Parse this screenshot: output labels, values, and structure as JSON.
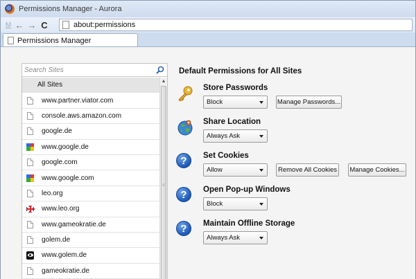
{
  "window": {
    "title": "Permissions Manager - Aurora"
  },
  "navbar": {
    "m_label": "M",
    "back_label": "←",
    "forward_label": "→",
    "reload_label": "C",
    "url": "about:permissions"
  },
  "tab": {
    "label": "Permissions Manager"
  },
  "sidebar": {
    "search_placeholder": "Search Sites",
    "items": [
      {
        "label": "All Sites",
        "icon": "none",
        "selected": true
      },
      {
        "label": "www.partner.viator.com",
        "icon": "page-icon"
      },
      {
        "label": "console.aws.amazon.com",
        "icon": "page-icon"
      },
      {
        "label": "google.de",
        "icon": "page-icon"
      },
      {
        "label": "www.google.de",
        "icon": "google-icon"
      },
      {
        "label": "google.com",
        "icon": "page-icon"
      },
      {
        "label": "www.google.com",
        "icon": "google-icon"
      },
      {
        "label": "leo.org",
        "icon": "page-icon"
      },
      {
        "label": "www.leo.org",
        "icon": "uk-flag-icon"
      },
      {
        "label": "www.gameokratie.de",
        "icon": "page-icon"
      },
      {
        "label": "golem.de",
        "icon": "page-icon"
      },
      {
        "label": "www.golem.de",
        "icon": "eye-icon"
      },
      {
        "label": "gameokratie.de",
        "icon": "page-icon"
      }
    ]
  },
  "main": {
    "title": "Default Permissions for All Sites",
    "permissions": [
      {
        "label": "Store Passwords",
        "icon": "key-icon",
        "select": "Block",
        "buttons": [
          "Manage Passwords..."
        ]
      },
      {
        "label": "Share Location",
        "icon": "globe-icon",
        "select": "Always Ask",
        "buttons": []
      },
      {
        "label": "Set Cookies",
        "icon": "question-icon",
        "select": "Allow",
        "buttons": [
          "Remove All Cookies",
          "Manage Cookies..."
        ]
      },
      {
        "label": "Open Pop-up Windows",
        "icon": "question-icon",
        "select": "Block",
        "buttons": []
      },
      {
        "label": "Maintain Offline Storage",
        "icon": "question-icon",
        "select": "Always Ask",
        "buttons": []
      }
    ]
  }
}
